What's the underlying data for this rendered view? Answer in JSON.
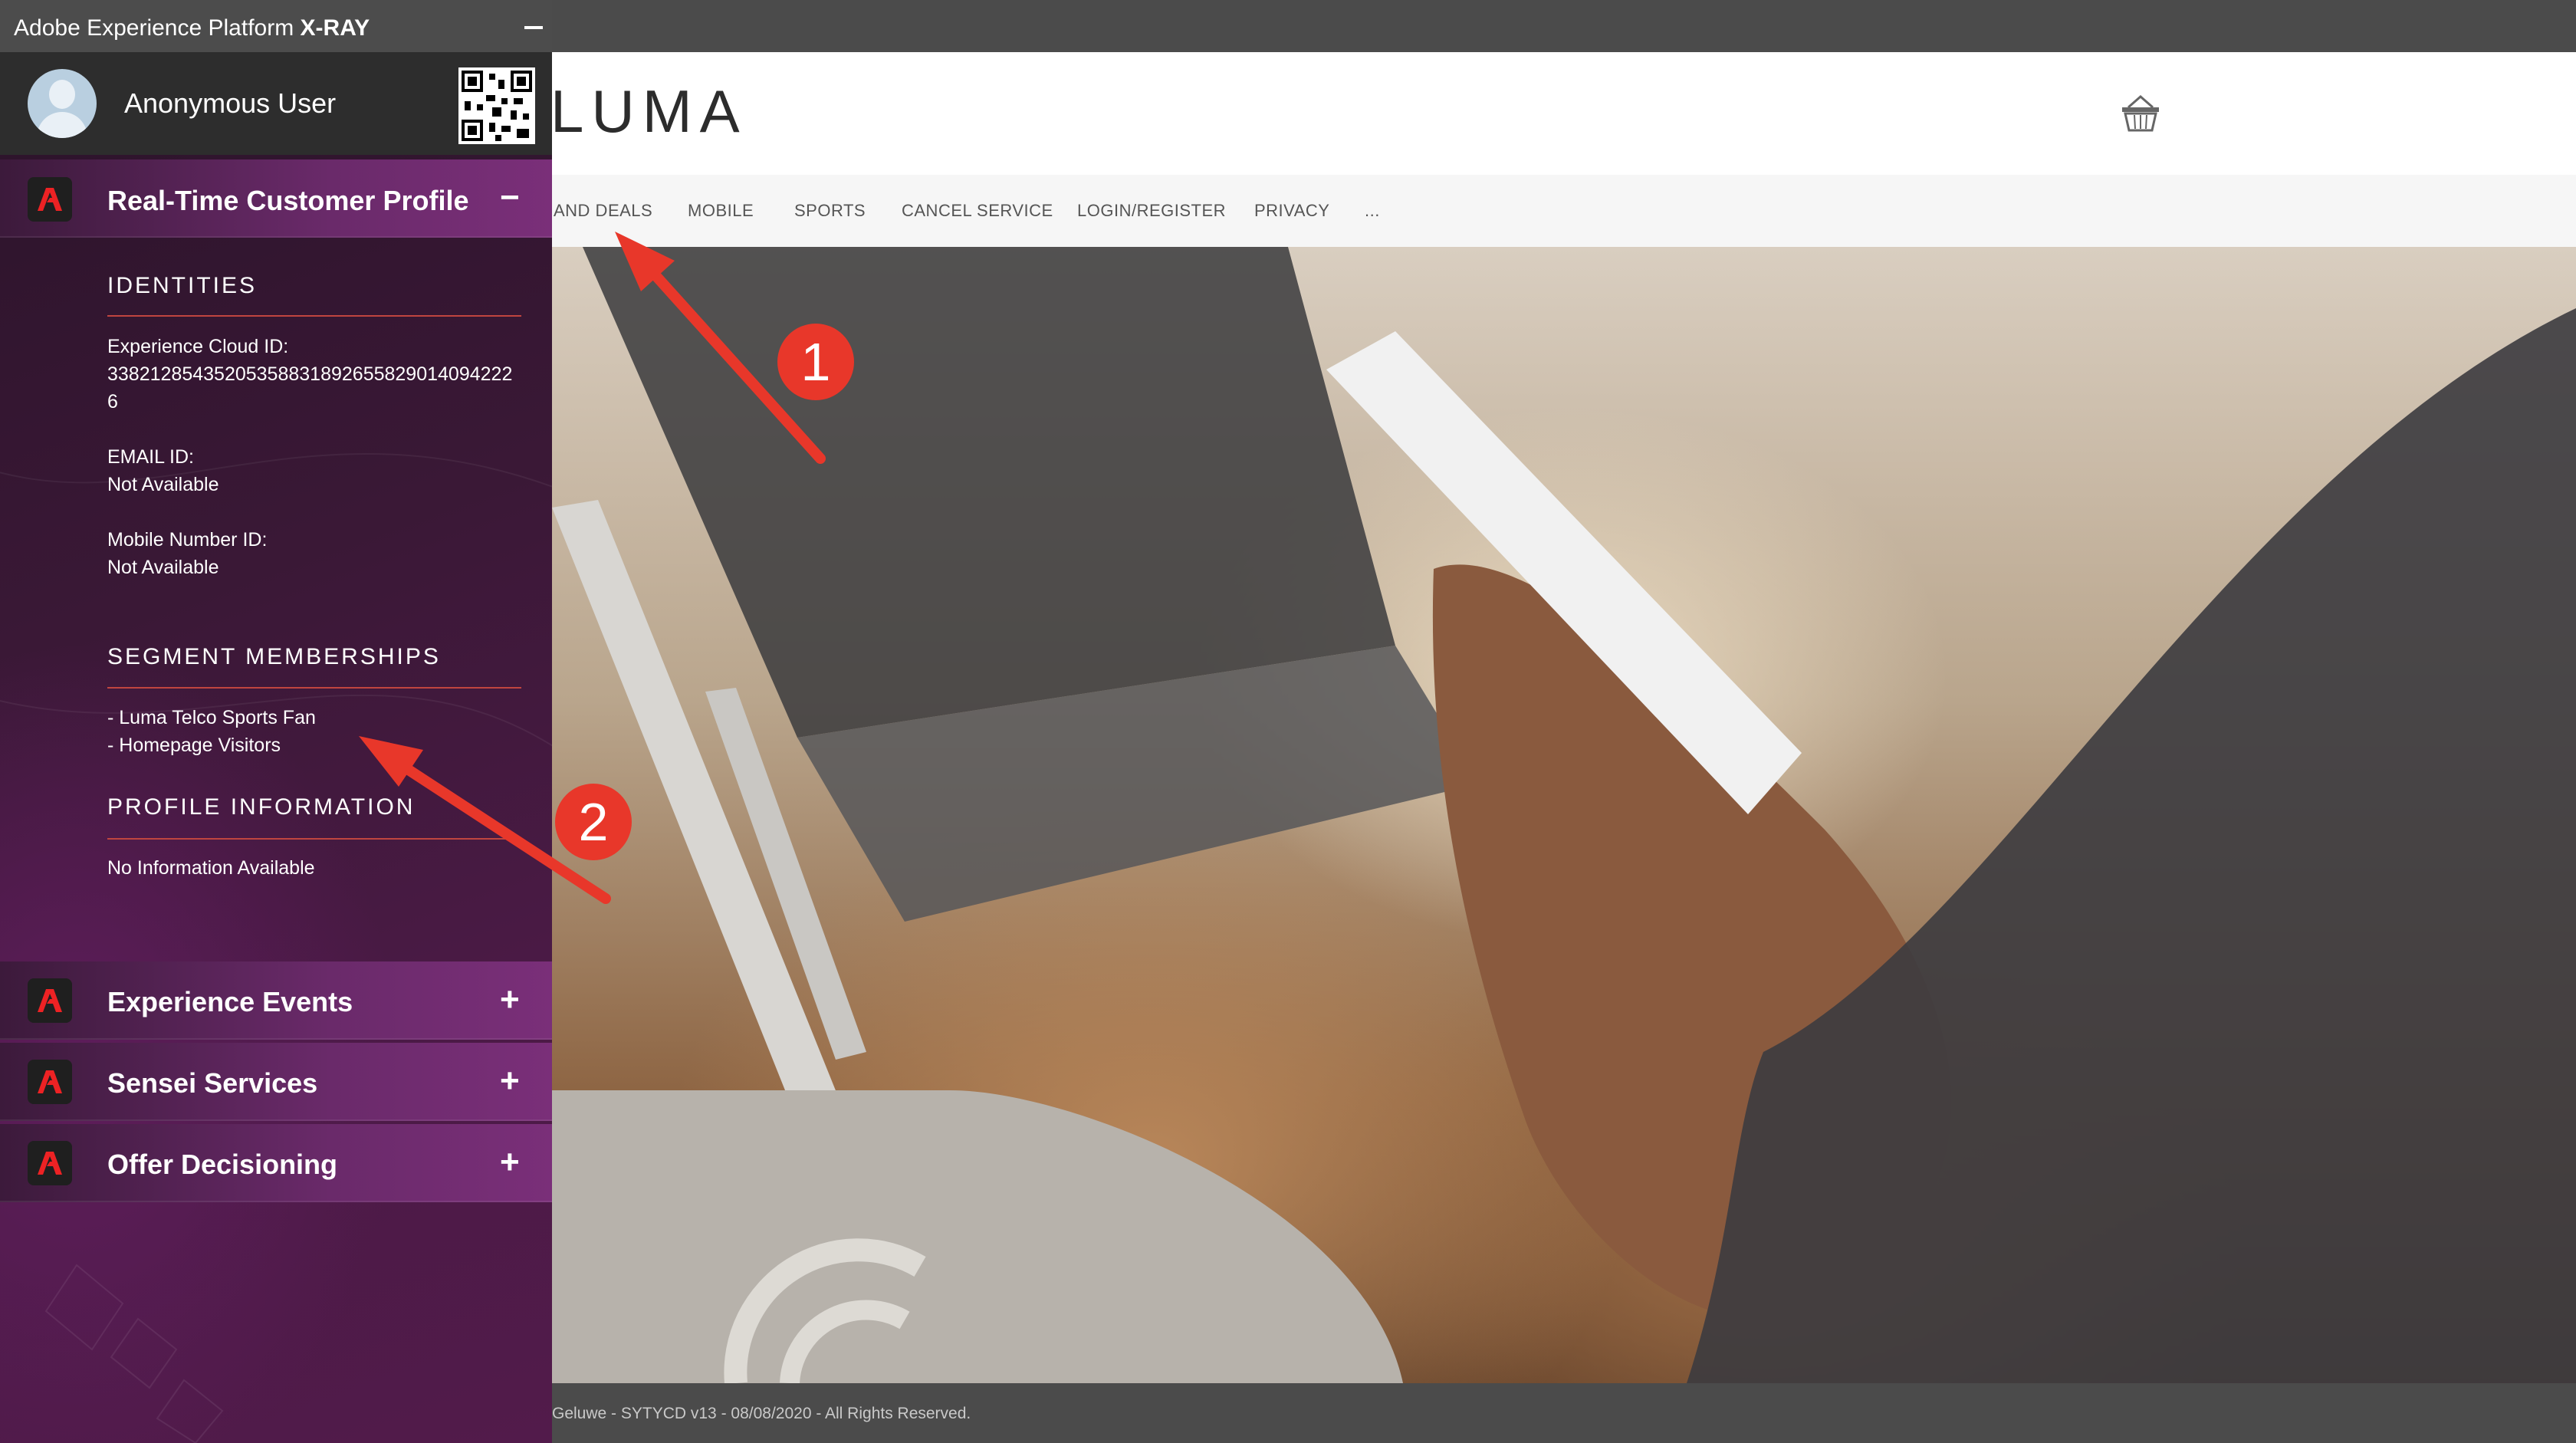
{
  "xray": {
    "title_prefix": "Adobe Experience Platform ",
    "title_bold": "X-RAY",
    "user_name": "Anonymous User",
    "sections": {
      "profile": {
        "title": "Real-Time Customer Profile",
        "toggle": "−",
        "identities_heading": "IDENTITIES",
        "ecid_label": "Experience Cloud ID:",
        "ecid_value_line1": "33821285435205358831892655829014094222",
        "ecid_value_line2": "6",
        "email_label": "EMAIL ID:",
        "email_value": "Not Available",
        "mobile_label": "Mobile Number ID:",
        "mobile_value": "Not Available",
        "segments_heading": "SEGMENT MEMBERSHIPS",
        "segments": [
          "- Luma Telco Sports Fan",
          "- Homepage Visitors"
        ],
        "profile_info_heading": "PROFILE INFORMATION",
        "profile_info_value": "No Information Available"
      },
      "experience_events": {
        "title": "Experience Events",
        "toggle": "+"
      },
      "sensei": {
        "title": "Sensei Services",
        "toggle": "+"
      },
      "offer": {
        "title": "Offer Decisioning",
        "toggle": "+"
      }
    }
  },
  "site": {
    "logo": "LUMA",
    "nav": [
      "AND DEALS",
      "MOBILE",
      "SPORTS",
      "CANCEL SERVICE",
      "LOGIN/REGISTER",
      "PRIVACY",
      "..."
    ],
    "footer": "Geluwe - SYTYCD v13 - 08/08/2020 - All Rights Reserved."
  },
  "annotations": {
    "marker1": "1",
    "marker2": "2",
    "color": "#e8372a"
  }
}
